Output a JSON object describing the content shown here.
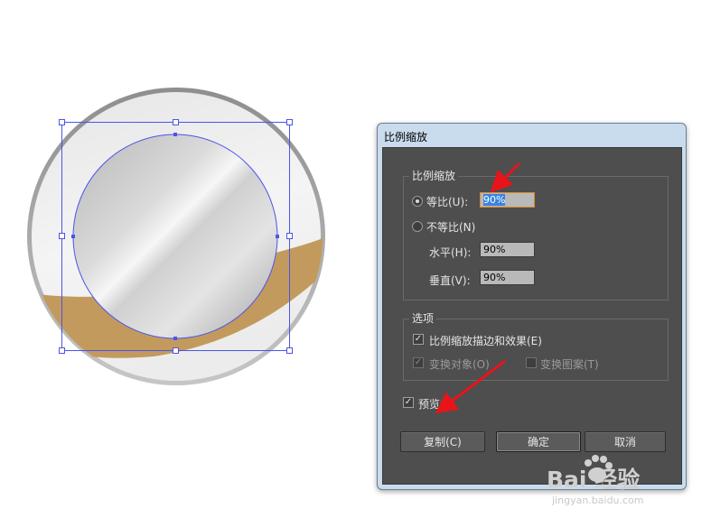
{
  "dialog": {
    "title": "比例缩放",
    "scale_group": {
      "legend": "比例缩放",
      "uniform_label": "等比(U):",
      "uniform_value": "90%",
      "uniform_selected": true,
      "nonuniform_label": "不等比(N)",
      "horizontal_label": "水平(H):",
      "horizontal_value": "90%",
      "vertical_label": "垂直(V):",
      "vertical_value": "90%"
    },
    "options_group": {
      "legend": "选项",
      "scale_strokes_label": "比例缩放描边和效果(E)",
      "scale_strokes_checked": true,
      "transform_objects_label": "变换对象(O)",
      "transform_objects_checked": true,
      "transform_patterns_label": "变换图案(T)",
      "transform_patterns_checked": false
    },
    "preview_label": "预览(P)",
    "preview_checked": true,
    "buttons": {
      "copy": "复制(C)",
      "ok": "确定",
      "cancel": "取消"
    }
  },
  "watermark": {
    "main": "Bai 经验",
    "sub": "jingyan.baidu.com"
  },
  "colors": {
    "selection_blue": "#4a55e8",
    "annotation_red": "#e8141a",
    "band_gold": "#c39a5e",
    "ring_gray": "#9a9a9a"
  }
}
